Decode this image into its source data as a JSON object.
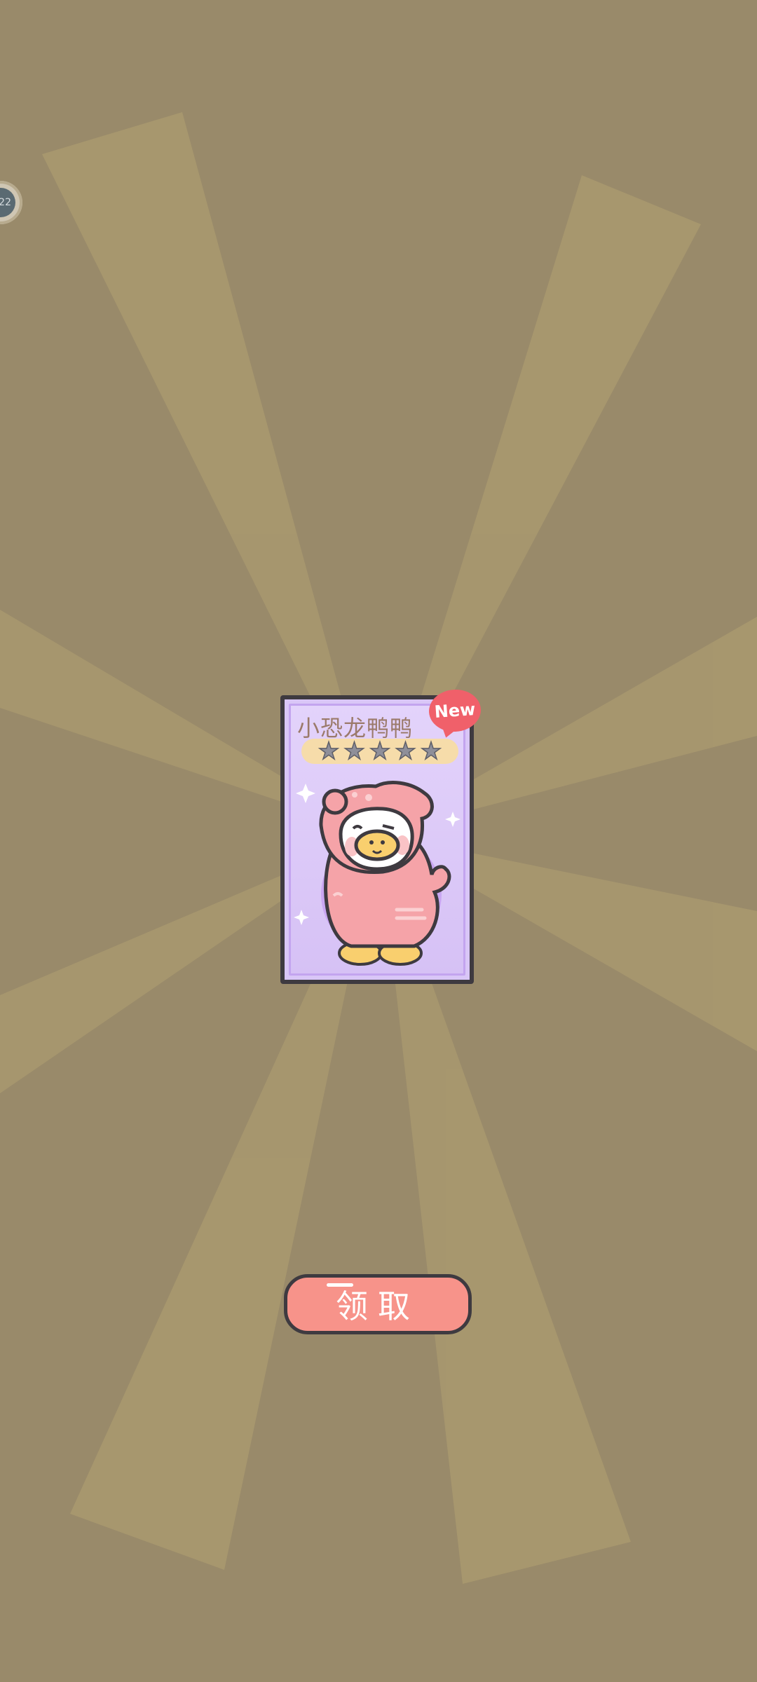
{
  "float_badge": {
    "text": "22"
  },
  "card": {
    "title": "小恐龙鸭鸭",
    "badge": "New",
    "stars_total": 5,
    "stars_filled": 0,
    "colors": {
      "card": "#d9c6f7",
      "badge": "#f0606a",
      "character": "#f5a3a8"
    },
    "character_icon": "dinosaur-duck-character"
  },
  "claim_button": {
    "label": "领取",
    "color": "#f7938a"
  },
  "background": {
    "color": "#998a6a",
    "ray_color": "#a9996f"
  }
}
